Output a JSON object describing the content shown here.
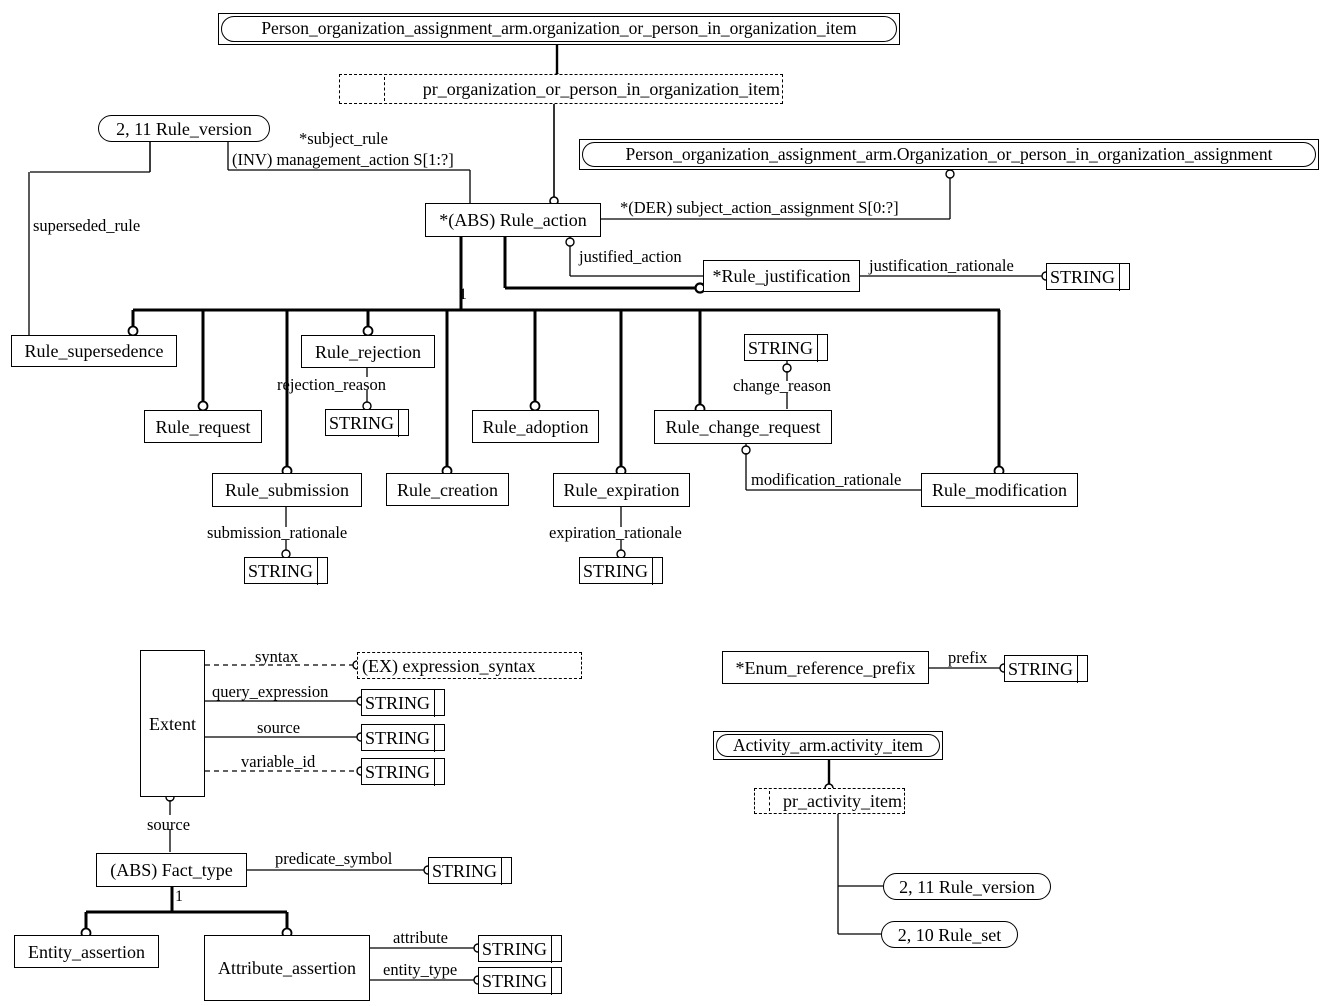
{
  "diagram": {
    "title": "EXPRESS-G Rule management ARM diagram",
    "type": "express-g"
  },
  "nodes": {
    "person_org_item": "Person_organization_assignment_arm.organization_or_person_in_organization_item",
    "pr_org_item": "pr_organization_or_person_in_organization_item",
    "rule_version_top": "2, 11 Rule_version",
    "person_org_assignment": "Person_organization_assignment_arm.Organization_or_person_in_organization_assignment",
    "rule_action": "*(ABS) Rule_action",
    "rule_justification": "*Rule_justification",
    "str_justification_rationale": "STRING",
    "rule_supersedence": "Rule_supersedence",
    "rule_request": "Rule_request",
    "rule_rejection": "Rule_rejection",
    "str_rejection_reason": "STRING",
    "rule_submission": "Rule_submission",
    "str_submission_rationale": "STRING",
    "rule_creation": "Rule_creation",
    "rule_adoption": "Rule_adoption",
    "rule_expiration": "Rule_expiration",
    "str_expiration_rationale": "STRING",
    "str_change_reason": "STRING",
    "rule_change_request": "Rule_change_request",
    "rule_modification": "Rule_modification",
    "extent": "Extent",
    "expression_syntax": "(EX) expression_syntax",
    "str_query_expression": "STRING",
    "str_source": "STRING",
    "str_variable_id": "STRING",
    "fact_type": "(ABS) Fact_type",
    "str_predicate_symbol": "STRING",
    "entity_assertion": "Entity_assertion",
    "attribute_assertion": "Attribute_assertion",
    "str_attribute": "STRING",
    "str_entity_type": "STRING",
    "enum_reference_prefix": "*Enum_reference_prefix",
    "str_prefix": "STRING",
    "activity_item": "Activity_arm.activity_item",
    "pr_activity_item": "pr_activity_item",
    "rule_version_bottom": "2, 11 Rule_version",
    "rule_set": "2, 10 Rule_set"
  },
  "edge_labels": {
    "subject_rule": "*subject_rule",
    "management_action": "(INV) management_action S[1:?]",
    "superseded_rule": "superseded_rule",
    "subject_action_assignment": "*(DER) subject_action_assignment S[0:?]",
    "justified_action": "justified_action",
    "justification_rationale": "justification_rationale",
    "supertype_count": "1",
    "rejection_reason": "rejection_reason",
    "submission_rationale": "submission_rationale",
    "expiration_rationale": "expiration_rationale",
    "change_reason": "change_reason",
    "modification_rationale": "modification_rationale",
    "syntax": "syntax",
    "query_expression": "query_expression",
    "source_attr": "source",
    "variable_id": "variable_id",
    "extent_source": "source",
    "fact_type_count": "1",
    "predicate_symbol": "predicate_symbol",
    "attribute": "attribute",
    "entity_type": "entity_type",
    "prefix": "prefix"
  },
  "colors": {
    "line": "#000000",
    "background": "#ffffff",
    "text": "#000000"
  }
}
